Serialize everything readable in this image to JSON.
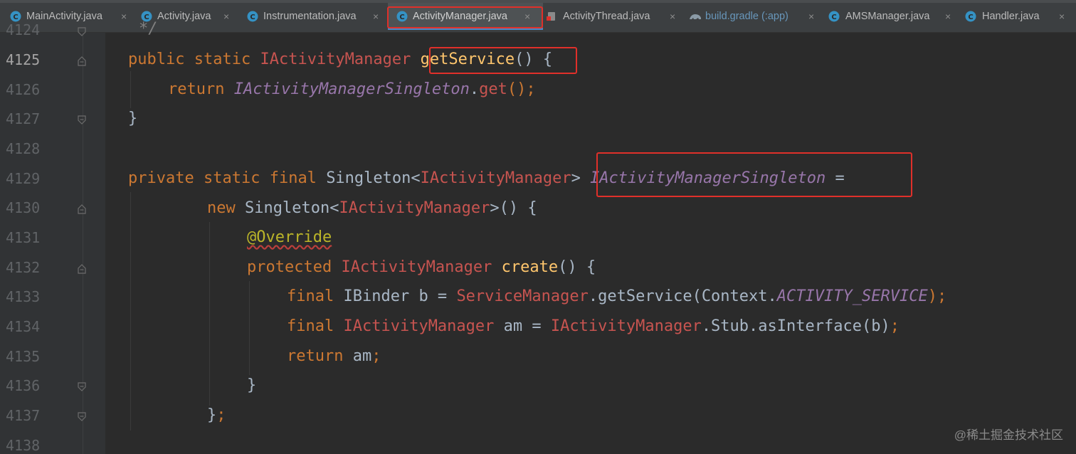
{
  "tabs": [
    {
      "label": "MainActivity.java",
      "icon": "class-icon"
    },
    {
      "label": "Activity.java",
      "icon": "class-icon"
    },
    {
      "label": "Instrumentation.java",
      "icon": "class-icon"
    },
    {
      "label": "ActivityManager.java",
      "icon": "class-icon",
      "active": true
    },
    {
      "label": "ActivityThread.java",
      "icon": "class-icon"
    },
    {
      "label": "build.gradle (:app)",
      "icon": "gradle-icon"
    },
    {
      "label": "AMSManager.java",
      "icon": "class-icon"
    },
    {
      "label": "Handler.java",
      "icon": "class-icon"
    }
  ],
  "close_glyph": "×",
  "line_numbers": [
    "4124",
    "4125",
    "4126",
    "4127",
    "4128",
    "4129",
    "4130",
    "4131",
    "4132",
    "4133",
    "4134",
    "4135",
    "4136",
    "4137",
    "4138"
  ],
  "code": {
    "l4124_comment": "*/",
    "l4125": {
      "kw1": "public",
      "kw2": "static",
      "type": "IActivityManager",
      "method": "getService",
      "rest": "() {"
    },
    "l4126": {
      "kw": "return",
      "field": "IActivityManagerSingleton",
      "dot": ".",
      "call": "get",
      "rest": "();"
    },
    "l4127": "}",
    "l4129": {
      "kw1": "private",
      "kw2": "static",
      "kw3": "final",
      "generic": "Singleton<",
      "type": "IActivityManager",
      "close": ">",
      "field": "IActivityManagerSingleton",
      "eq": "="
    },
    "l4130": {
      "kw": "new",
      "generic": "Singleton<",
      "type": "IActivityManager",
      "rest": ">() {"
    },
    "l4131": "@Override",
    "l4132": {
      "kw": "protected",
      "type": "IActivityManager",
      "method": "create",
      "rest": "() {"
    },
    "l4133": {
      "kw": "final",
      "t1": "IBinder b = ",
      "cls": "ServiceManager",
      "call": ".getService(Context.",
      "const": "ACTIVITY_SERVICE",
      "end": ");"
    },
    "l4134": {
      "kw": "final",
      "type": "IActivityManager",
      "mid": " am = ",
      "cls": "IActivityManager",
      "call": ".Stub.asInterface(b)",
      "end": ";"
    },
    "l4135": {
      "kw": "return",
      "rest": " am",
      "end": ";"
    },
    "l4136": "}",
    "l4137": {
      "brace": "}",
      "end": ";"
    }
  },
  "watermark": "@稀土掘金技术社区",
  "colors": {
    "highlight": "#e0302a",
    "keyword": "#cc7832",
    "class": "#c75450",
    "method": "#ffc66d",
    "field": "#9876aa"
  }
}
